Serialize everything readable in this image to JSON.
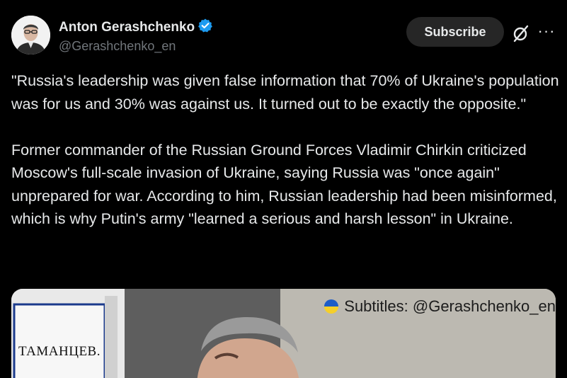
{
  "author": {
    "display_name": "Anton Gerashchenko",
    "handle": "@Gerashchenko_en",
    "verified": true,
    "verified_color": "#1d9bf0"
  },
  "actions": {
    "subscribe_label": "Subscribe",
    "grok_icon": "grok-slash-icon",
    "more_icon": "more-dots-icon"
  },
  "post": {
    "paragraphs": [
      "\"Russia's leadership was given false information that 70% of Ukraine's population was for us and 30% was against us. It turned out to be exactly the opposite.\"",
      "Former commander of the Russian Ground Forces Vladimir Chirkin criticized Moscow's full-scale invasion of Ukraine, saying Russia was \"once again\" unprepared for war. According to him, Russian leadership had been misinformed, which is why Putin's army \"learned a serious and harsh lesson\" in Ukraine."
    ]
  },
  "media": {
    "subtitle_overlay": "Subtitles: @Gerashchenko_en",
    "sign_text": "ТАМАНЦЕВ.",
    "flag_colors": [
      "#1c5cc8",
      "#f5cf2a"
    ]
  },
  "colors": {
    "background": "#000000",
    "text": "#e7e9ea",
    "secondary_text": "#71767b",
    "button_bg": "#262626"
  }
}
